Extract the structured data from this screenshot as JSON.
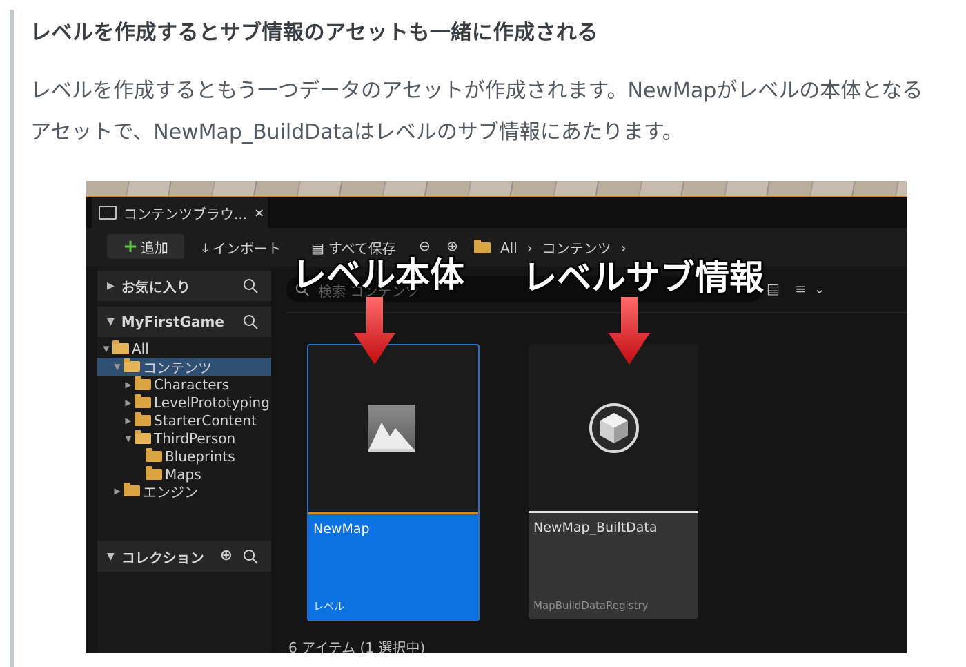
{
  "article": {
    "heading": "レベルを作成するとサブ情報のアセットも一緒に作成される",
    "paragraph_line1": "レベルを作成するともう一つデータのアセットが作成されます。NewMapがレベルの本体となる",
    "paragraph_line2": "アセットで、NewMap_BuildDataはレベルのサブ情報にあたります。"
  },
  "editor": {
    "tab_label": "コンテンツブラウ...",
    "tab_close": "×",
    "toolbar": {
      "add_label": "追加",
      "import_label": "インポート",
      "save_all_label": "すべて保存",
      "path_root": "All",
      "path_sep": "›",
      "path_content": "コンテンツ"
    },
    "sidebar": {
      "favorites_label": "お気に入り",
      "project_label": "MyFirstGame",
      "collections_label": "コレクション",
      "tree": [
        {
          "label": "All"
        },
        {
          "label": "コンテンツ"
        },
        {
          "label": "Characters"
        },
        {
          "label": "LevelPrototyping"
        },
        {
          "label": "StarterContent"
        },
        {
          "label": "ThirdPerson"
        },
        {
          "label": "Blueprints"
        },
        {
          "label": "Maps"
        },
        {
          "label": "エンジン"
        }
      ]
    },
    "search_placeholder": "検索 コンテンツ",
    "assets": [
      {
        "name": "NewMap",
        "type": "レベル",
        "selected": true
      },
      {
        "name": "NewMap_BuiltData",
        "type": "MapBuildDataRegistry",
        "selected": false
      }
    ],
    "status_text": "6 アイテム (1 選択中)"
  },
  "annotations": {
    "left": "レベル本体",
    "right": "レベルサブ情報",
    "arrow_color": "#d8161b"
  },
  "colors": {
    "selection_blue": "#0b70e0",
    "accent_orange": "#d68a2a",
    "add_green": "#5fc845"
  }
}
